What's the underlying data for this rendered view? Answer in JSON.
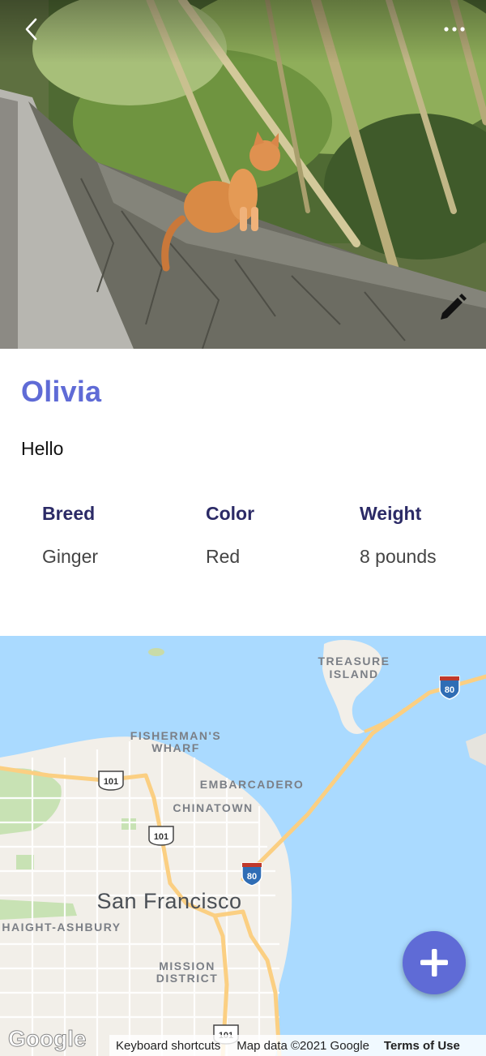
{
  "pet": {
    "name": "Olivia",
    "description": "Hello"
  },
  "attributes": [
    {
      "label": "Breed",
      "value": "Ginger"
    },
    {
      "label": "Color",
      "value": "Red"
    },
    {
      "label": "Weight",
      "value": "8 pounds"
    }
  ],
  "map": {
    "labels": {
      "treasure_island_1": "TREASURE",
      "treasure_island_2": "ISLAND",
      "fishermans_wharf_1": "FISHERMAN'S",
      "fishermans_wharf_2": "WHARF",
      "embarcadero": "EMBARCADERO",
      "chinatown": "CHINATOWN",
      "city": "San Francisco",
      "haight": "HAIGHT-ASHBURY",
      "mission_1": "MISSION",
      "mission_2": "DISTRICT"
    },
    "shields": {
      "i80_a": "80",
      "i80_b": "80",
      "us101_a": "101",
      "us101_b": "101",
      "us101_c": "101"
    },
    "logo": "Google",
    "footer": {
      "shortcuts": "Keyboard shortcuts",
      "attribution": "Map data ©2021 Google",
      "terms": "Terms of Use"
    }
  },
  "icons": {
    "back": "chevron-left-icon",
    "more": "more-horizontal-icon",
    "edit": "pencil-icon",
    "add": "plus-icon"
  },
  "colors": {
    "accent": "#5f6bd6",
    "label": "#2b2a66",
    "water": "#aadaff",
    "land": "#f2efe9"
  }
}
